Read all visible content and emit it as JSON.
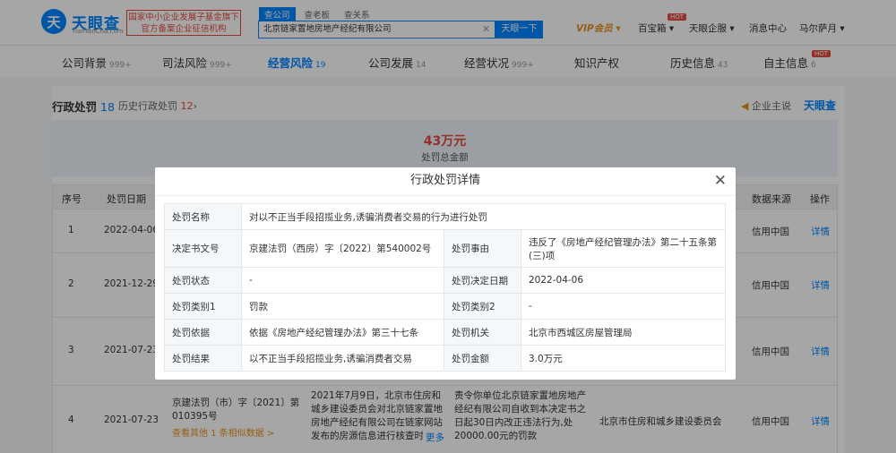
{
  "header": {
    "logo_mark": "天",
    "logo_text": "天眼查",
    "logo_sub": "TianYanCha.com",
    "badge_line1": "国家中小企业发展子基金旗下",
    "badge_line2": "官方备案企业征信机构",
    "search_tabs": [
      "查公司",
      "查老板",
      "查关系"
    ],
    "search_value": "北京链家置地房地产经纪有限公司",
    "search_button": "天眼一下",
    "vip": "VIP会员",
    "nav_baobao": "百宝箱",
    "nav_qifu": "天眼企服",
    "nav_msg": "消息中心",
    "nav_user": "马尔萨月",
    "hot": "HOT"
  },
  "tabs": [
    {
      "label": "公司背景",
      "count": "999+"
    },
    {
      "label": "司法风险",
      "count": "999+"
    },
    {
      "label": "经营风险",
      "count": "19"
    },
    {
      "label": "公司发展",
      "count": "14"
    },
    {
      "label": "经营状况",
      "count": "999+"
    },
    {
      "label": "知识产权",
      "count": ""
    },
    {
      "label": "历史信息",
      "count": "43"
    },
    {
      "label": "自主信息",
      "count": "6"
    }
  ],
  "panel": {
    "title": "行政处罚",
    "title_count": "18",
    "history": "历史行政处罚",
    "history_count": "12",
    "owner": "企业主说",
    "brand": "天眼查",
    "total_value": "43万元",
    "total_label": "处罚总金额"
  },
  "table": {
    "headers": [
      "序号",
      "处罚日期",
      "数据来源",
      "操作"
    ],
    "rows": [
      {
        "no": "1",
        "date": "2022-04-06",
        "source": "信用中国",
        "op": "详情"
      },
      {
        "no": "2",
        "date": "2021-12-29",
        "source": "信用中国",
        "op": "详情"
      },
      {
        "no": "3",
        "date": "2021-07-23",
        "source": "信用中国",
        "op": "详情"
      },
      {
        "no": "4",
        "date": "2021-07-23",
        "source": "信用中国",
        "op": "详情",
        "doc": "京建法罚（市）字〔2021〕第010395号",
        "more_link": "查看其他 1 条相似数据 >",
        "reason": "2021年7月9日，北京市住房和城乡建设委员会对北京链家置地房地产经纪有限公司在链家网站发布的房源信息进行核查时",
        "more": "更多",
        "result": "责令你单位北京链家置地房地产经纪有限公司自收到本决定书之日起30日内改正违法行为,处20000.00元的罚款",
        "org": "北京市住房和城乡建设委员会"
      }
    ]
  },
  "modal": {
    "title": "行政处罚详情",
    "k_name": "处罚名称",
    "v_name": "对以不正当手段招揽业务,诱骗消费者交易的行为进行处罚",
    "k_doc": "决定书文号",
    "v_doc": "京建法罚（西房）字〔2022〕第540002号",
    "k_reason": "处罚事由",
    "v_reason": "违反了《房地产经纪管理办法》第二十五条第(三)项",
    "k_status": "处罚状态",
    "v_status": "-",
    "k_date": "处罚决定日期",
    "v_date": "2022-04-06",
    "k_type1": "处罚类别1",
    "v_type1": "罚款",
    "k_type2": "处罚类别2",
    "v_type2": "-",
    "k_basis": "处罚依据",
    "v_basis": "依据《房地产经纪管理办法》第三十七条",
    "k_org": "处罚机关",
    "v_org": "北京市西城区房屋管理局",
    "k_result": "处罚结果",
    "v_result": "以不正当手段招揽业务,诱骗消费者交易",
    "k_amount": "处罚金额",
    "v_amount": "3.0万元"
  }
}
